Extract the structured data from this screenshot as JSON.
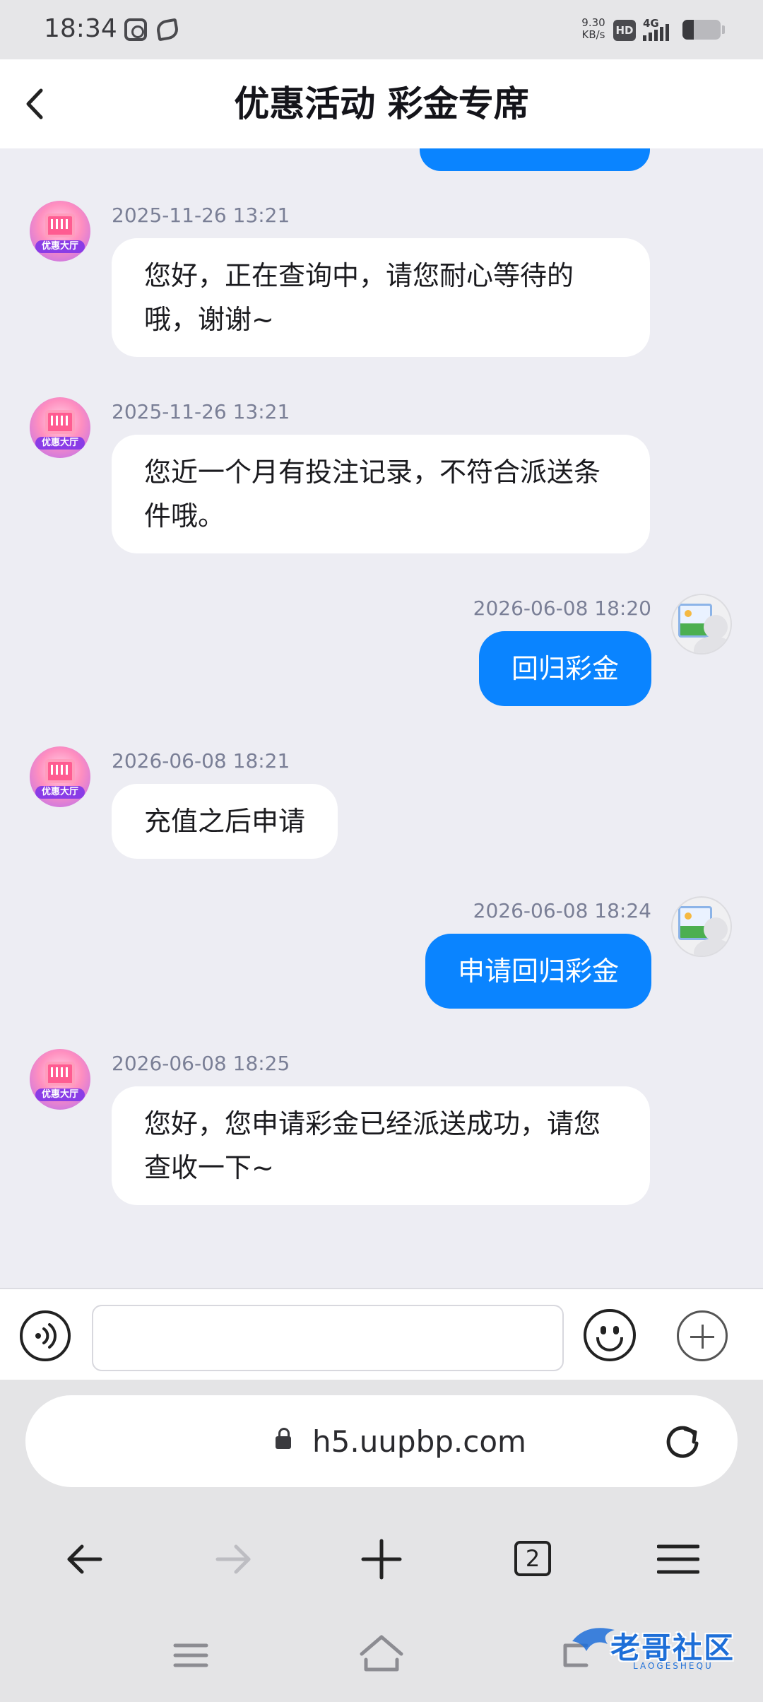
{
  "status_bar": {
    "time": "18:34",
    "net_speed": "9.30 KB/s",
    "hd": "HD",
    "network": "4G",
    "battery_level": 0.3,
    "icons": [
      "app-icon-1",
      "app-icon-2",
      "hd-icon",
      "signal-icon",
      "battery-icon"
    ]
  },
  "header": {
    "title": "优惠活动 彩金专席",
    "back_icon": "chevron-left-icon"
  },
  "messages": [
    {
      "side": "in",
      "timestamp": "2025-11-26 13:21",
      "text": "您好，正在查询中，请您耐心等待的哦，谢谢~"
    },
    {
      "side": "in",
      "timestamp": "2025-11-26 13:21",
      "text": "您近一个月有投注记录，不符合派送条件哦。"
    },
    {
      "side": "out",
      "timestamp": "2026-06-08 18:20",
      "text": "回归彩金"
    },
    {
      "side": "in",
      "timestamp": "2026-06-08 18:21",
      "text": "充值之后申请"
    },
    {
      "side": "out",
      "timestamp": "2026-06-08 18:24",
      "text": "申请回归彩金"
    },
    {
      "side": "in",
      "timestamp": "2026-06-08 18:25",
      "text": "您好，您申请彩金已经派送成功，请您查收一下~"
    }
  ],
  "bot_avatar_label": "优惠大厅",
  "input_bar": {
    "placeholder": "",
    "voice_icon": "voice-icon",
    "emoji_icon": "emoji-icon",
    "plus_icon": "plus-icon"
  },
  "browser": {
    "url": "h5.uupbp.com",
    "tab_count": "2",
    "icons": [
      "lock-icon",
      "reload-icon",
      "back-arrow-icon",
      "forward-arrow-icon",
      "new-tab-icon",
      "tabs-icon",
      "menu-icon"
    ]
  },
  "watermark": {
    "text": "老哥社区",
    "sub": "LAOGESHEQU"
  },
  "colors": {
    "accent": "#0a84ff",
    "background": "#ededf3",
    "bubble_in": "#ffffff",
    "timestamp": "#7a7f96"
  }
}
